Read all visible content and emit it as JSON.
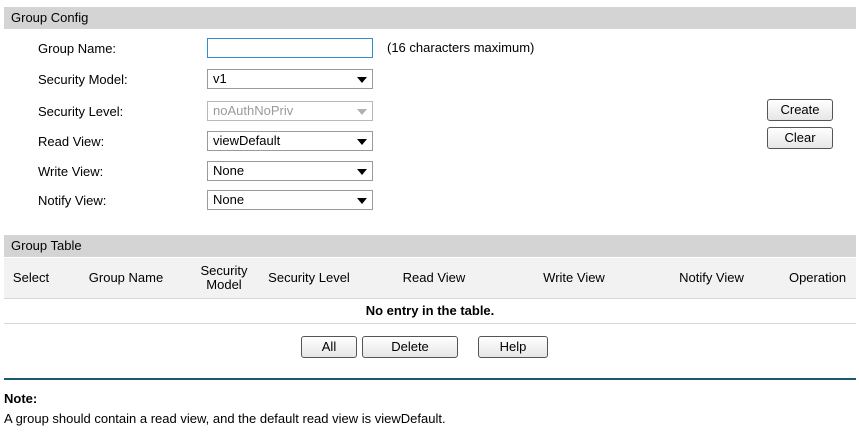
{
  "group_config": {
    "title": "Group Config",
    "group_name": {
      "label": "Group Name:",
      "value": "",
      "hint": "(16 characters maximum)"
    },
    "security_model": {
      "label": "Security Model:",
      "value": "v1"
    },
    "security_level": {
      "label": "Security Level:",
      "value": "noAuthNoPriv"
    },
    "read_view": {
      "label": "Read View:",
      "value": "viewDefault"
    },
    "write_view": {
      "label": "Write View:",
      "value": "None"
    },
    "notify_view": {
      "label": "Notify View:",
      "value": "None"
    },
    "create_button": "Create",
    "clear_button": "Clear"
  },
  "group_table": {
    "title": "Group Table",
    "columns": {
      "select": "Select",
      "group_name": "Group Name",
      "security_model_line1": "Security",
      "security_model_line2": "Model",
      "security_level": "Security Level",
      "read_view": "Read View",
      "write_view": "Write View",
      "notify_view": "Notify View",
      "operation": "Operation"
    },
    "empty_message": "No entry in the table.",
    "buttons": {
      "all": "All",
      "delete": "Delete",
      "help": "Help"
    }
  },
  "note": {
    "title": "Note:",
    "text": "A group should contain a read view, and the default read view is viewDefault."
  }
}
